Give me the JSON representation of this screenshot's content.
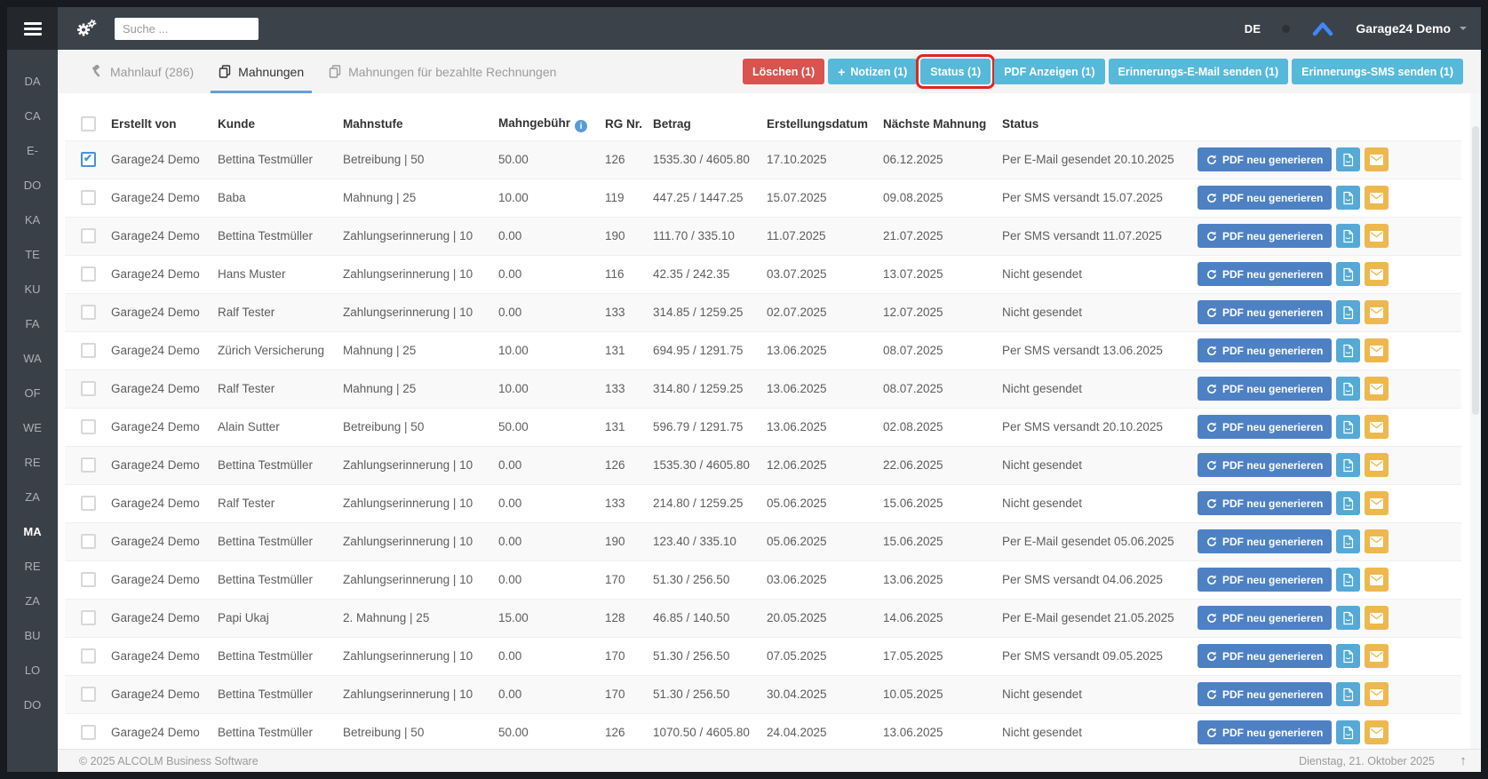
{
  "colors": {
    "accent_blue": "#56b9da",
    "danger_red": "#d9534f",
    "primary_blue": "#4e81c4",
    "mail_yellow": "#edb84e",
    "highlight_red": "#e2251b",
    "tab_underline": "#64a0d6"
  },
  "topbar": {
    "search_placeholder": "Suche ...",
    "language": "DE",
    "account": "Garage24 Demo"
  },
  "sidebar": {
    "items": [
      {
        "label": "DA"
      },
      {
        "label": "CA"
      },
      {
        "label": "E-"
      },
      {
        "label": "DO"
      },
      {
        "label": "KA"
      },
      {
        "label": "TE"
      },
      {
        "label": "KU"
      },
      {
        "label": "FA"
      },
      {
        "label": "WA"
      },
      {
        "label": "OF"
      },
      {
        "label": "WE"
      },
      {
        "label": "RE"
      },
      {
        "label": "ZA"
      },
      {
        "label": "MA",
        "active": true
      },
      {
        "label": "RE"
      },
      {
        "label": "ZA"
      },
      {
        "label": "BU"
      },
      {
        "label": "LO"
      },
      {
        "label": "DO"
      }
    ]
  },
  "tabs": [
    {
      "label": "Mahnlauf (286)",
      "gavel": true,
      "active": false
    },
    {
      "label": "Mahnungen",
      "copy": true,
      "active": true
    },
    {
      "label": "Mahnungen für bezahlte Rechnungen",
      "copy": true,
      "active": false
    }
  ],
  "toolbar": {
    "buttons": [
      {
        "label": "Löschen (1)",
        "variant": "danger"
      },
      {
        "label": "Notizen (1)",
        "variant": "info",
        "plus": true
      },
      {
        "label": "Status (1)",
        "variant": "info",
        "highlight": true
      },
      {
        "label": "PDF Anzeigen (1)",
        "variant": "info"
      },
      {
        "label": "Erinnerungs-E-Mail senden (1)",
        "variant": "info"
      },
      {
        "label": "Erinnerungs-SMS senden (1)",
        "variant": "info"
      }
    ]
  },
  "table": {
    "columns": [
      "Erstellt von",
      "Kunde",
      "Mahnstufe",
      "Mahngebühr",
      "RG Nr.",
      "Betrag",
      "Erstellungsdatum",
      "Nächste Mahnung",
      "Status"
    ],
    "row_action_label": "PDF neu generieren",
    "rows": [
      {
        "checked": true,
        "created_by": "Garage24 Demo",
        "customer": "Bettina Testmüller",
        "level": "Betreibung | 50",
        "fee": "50.00",
        "rg": "126",
        "amount": "1535.30 / 4605.80",
        "created": "17.10.2025",
        "next": "06.12.2025",
        "status": "Per E-Mail gesendet 20.10.2025"
      },
      {
        "created_by": "Garage24 Demo",
        "customer": "Baba",
        "level": "Mahnung | 25",
        "fee": "10.00",
        "rg": "119",
        "amount": "447.25 / 1447.25",
        "created": "15.07.2025",
        "next": "09.08.2025",
        "status": "Per SMS versandt 15.07.2025"
      },
      {
        "created_by": "Garage24 Demo",
        "customer": "Bettina Testmüller",
        "level": "Zahlungserinnerung | 10",
        "fee": "0.00",
        "rg": "190",
        "amount": "111.70 / 335.10",
        "created": "11.07.2025",
        "next": "21.07.2025",
        "status": "Per SMS versandt 11.07.2025"
      },
      {
        "created_by": "Garage24 Demo",
        "customer": "Hans Muster",
        "level": "Zahlungserinnerung | 10",
        "fee": "0.00",
        "rg": "116",
        "amount": "42.35 / 242.35",
        "created": "03.07.2025",
        "next": "13.07.2025",
        "status": "Nicht gesendet"
      },
      {
        "created_by": "Garage24 Demo",
        "customer": "Ralf Tester",
        "level": "Zahlungserinnerung | 10",
        "fee": "0.00",
        "rg": "133",
        "amount": "314.85 / 1259.25",
        "created": "02.07.2025",
        "next": "12.07.2025",
        "status": "Nicht gesendet"
      },
      {
        "marked": true,
        "created_by": "Garage24 Demo",
        "customer": "Zürich Versicherung",
        "level": "Mahnung | 25",
        "fee": "10.00",
        "rg": "131",
        "amount": "694.95 / 1291.75",
        "created": "13.06.2025",
        "next": "08.07.2025",
        "status": "Per SMS versandt 13.06.2025"
      },
      {
        "created_by": "Garage24 Demo",
        "customer": "Ralf Tester",
        "level": "Mahnung | 25",
        "fee": "10.00",
        "rg": "133",
        "amount": "314.80 / 1259.25",
        "created": "13.06.2025",
        "next": "08.07.2025",
        "status": "Nicht gesendet"
      },
      {
        "created_by": "Garage24 Demo",
        "customer": "Alain Sutter",
        "level": "Betreibung | 50",
        "fee": "50.00",
        "rg": "131",
        "amount": "596.79 / 1291.75",
        "created": "13.06.2025",
        "next": "02.08.2025",
        "status": "Per SMS versandt 20.10.2025"
      },
      {
        "created_by": "Garage24 Demo",
        "customer": "Bettina Testmüller",
        "level": "Zahlungserinnerung | 10",
        "fee": "0.00",
        "rg": "126",
        "amount": "1535.30 / 4605.80",
        "created": "12.06.2025",
        "next": "22.06.2025",
        "status": "Nicht gesendet"
      },
      {
        "created_by": "Garage24 Demo",
        "customer": "Ralf Tester",
        "level": "Zahlungserinnerung | 10",
        "fee": "0.00",
        "rg": "133",
        "amount": "214.80 / 1259.25",
        "created": "05.06.2025",
        "next": "15.06.2025",
        "status": "Nicht gesendet"
      },
      {
        "created_by": "Garage24 Demo",
        "customer": "Bettina Testmüller",
        "level": "Zahlungserinnerung | 10",
        "fee": "0.00",
        "rg": "190",
        "amount": "123.40 / 335.10",
        "created": "05.06.2025",
        "next": "15.06.2025",
        "status": "Per E-Mail gesendet 05.06.2025"
      },
      {
        "created_by": "Garage24 Demo",
        "customer": "Bettina Testmüller",
        "level": "Zahlungserinnerung | 10",
        "fee": "0.00",
        "rg": "170",
        "amount": "51.30 / 256.50",
        "created": "03.06.2025",
        "next": "13.06.2025",
        "status": "Per SMS versandt 04.06.2025"
      },
      {
        "created_by": "Garage24 Demo",
        "customer": "Papi Ukaj",
        "level": "2. Mahnung | 25",
        "fee": "15.00",
        "rg": "128",
        "amount": "46.85 / 140.50",
        "created": "20.05.2025",
        "next": "14.06.2025",
        "status": "Per E-Mail gesendet 21.05.2025"
      },
      {
        "created_by": "Garage24 Demo",
        "customer": "Bettina Testmüller",
        "level": "Zahlungserinnerung | 10",
        "fee": "0.00",
        "rg": "170",
        "amount": "51.30 / 256.50",
        "created": "07.05.2025",
        "next": "17.05.2025",
        "status": "Per SMS versandt 09.05.2025"
      },
      {
        "created_by": "Garage24 Demo",
        "customer": "Bettina Testmüller",
        "level": "Zahlungserinnerung | 10",
        "fee": "0.00",
        "rg": "170",
        "amount": "51.30 / 256.50",
        "created": "30.04.2025",
        "next": "10.05.2025",
        "status": "Nicht gesendet"
      },
      {
        "created_by": "Garage24 Demo",
        "customer": "Bettina Testmüller",
        "level": "Betreibung | 50",
        "fee": "50.00",
        "rg": "126",
        "amount": "1070.50 / 4605.80",
        "created": "24.04.2025",
        "next": "13.06.2025",
        "status": "Nicht gesendet"
      }
    ]
  },
  "footer": {
    "left": "© 2025 ALCOLM Business Software",
    "right": "Dienstag, 21. Oktober 2025"
  }
}
